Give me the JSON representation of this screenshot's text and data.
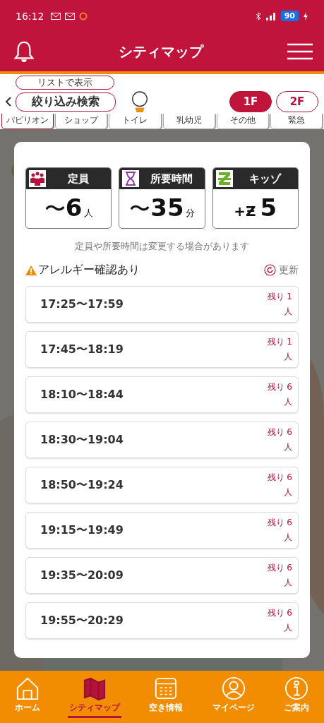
{
  "status_bar": {
    "time": "16:12",
    "battery": "90"
  },
  "header": {
    "title": "シティマップ"
  },
  "filter": {
    "list_button": "リストで表示",
    "search_button": "絞り込み検索",
    "categories": [
      {
        "label": "パビリオン",
        "selected": true
      },
      {
        "label": "ショップ",
        "selected": false
      },
      {
        "label": "トイレ",
        "selected": false
      },
      {
        "label": "乳幼児",
        "selected": false
      },
      {
        "label": "その他",
        "selected": false
      },
      {
        "label": "緊急",
        "selected": false
      }
    ],
    "floors": [
      {
        "label": "1F",
        "selected": true
      },
      {
        "label": "2F",
        "selected": false
      }
    ]
  },
  "modal": {
    "info_cards": [
      {
        "kind": "capacity",
        "title": "定員",
        "prefix": "〜",
        "value": "6",
        "unit": "人"
      },
      {
        "kind": "duration",
        "title": "所要時間",
        "prefix": "〜",
        "value": "35",
        "unit": "分"
      },
      {
        "kind": "kidzo",
        "title": "キッゾ",
        "prefix": "+Ƶ",
        "value": "5"
      }
    ],
    "note": "定員や所要時間は変更する場合があります",
    "allergy": "アレルギー確認あり",
    "refresh": "更新",
    "slots": [
      {
        "time": "17:25〜17:59",
        "remaining": "残り 1 人"
      },
      {
        "time": "17:45〜18:19",
        "remaining": "残り 1 人"
      },
      {
        "time": "18:10〜18:44",
        "remaining": "残り 6 人"
      },
      {
        "time": "18:30〜19:04",
        "remaining": "残り 6 人"
      },
      {
        "time": "18:50〜19:24",
        "remaining": "残り 6 人"
      },
      {
        "time": "19:15〜19:49",
        "remaining": "残り 6 人"
      },
      {
        "time": "19:35〜20:09",
        "remaining": "残り 6 人"
      },
      {
        "time": "19:55〜20:29",
        "remaining": "残り 6 人"
      }
    ]
  },
  "nav": [
    {
      "kind": "home",
      "label": "ホーム",
      "selected": false
    },
    {
      "kind": "map",
      "label": "シティマップ",
      "selected": true
    },
    {
      "kind": "calendar",
      "label": "空き情報",
      "selected": false
    },
    {
      "kind": "user",
      "label": "マイページ",
      "selected": false
    },
    {
      "kind": "info",
      "label": "ご案内",
      "selected": false
    }
  ]
}
